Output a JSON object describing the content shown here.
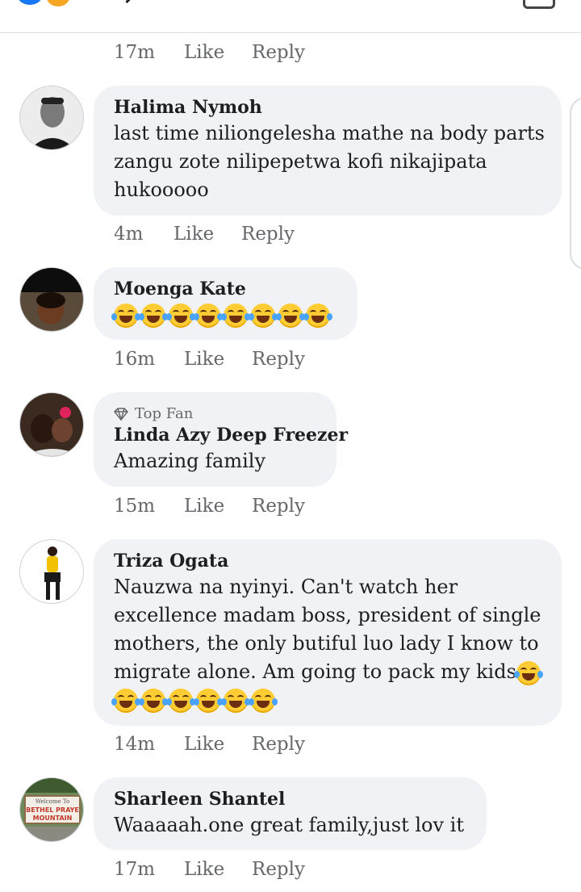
{
  "comments": [
    {
      "meta": {
        "time": "17m",
        "like": "Like",
        "reply": "Reply"
      }
    },
    {
      "name": "Halima Nymoh",
      "lines": [
        "last time niliongelesha mathe na body parts",
        "zangu zote nilipepetwa kofi nikajipata",
        "hukooooo"
      ],
      "meta": {
        "time": "4m",
        "like": "Like",
        "reply": "Reply"
      }
    },
    {
      "name": "Moenga Kate",
      "emoji_count": 8,
      "emoji_icon": "face-with-tears-of-joy",
      "meta": {
        "time": "16m",
        "like": "Like",
        "reply": "Reply"
      }
    },
    {
      "badge": "Top Fan",
      "badge_icon": "diamond-icon",
      "name": "Linda Azy Deep Freezer",
      "lines": [
        "Amazing  family"
      ],
      "meta": {
        "time": "15m",
        "like": "Like",
        "reply": "Reply"
      }
    },
    {
      "name": "Triza Ogata",
      "lines": [
        "Nauzwa na nyinyi. Can't watch her",
        "excellence madam boss, president of single",
        "mothers, the only butiful luo lady I know to",
        "migrate alone. Am going to pack my kids"
      ],
      "emoji_count": 6,
      "emoji_icon": "face-with-tears-of-joy",
      "meta": {
        "time": "14m",
        "like": "Like",
        "reply": "Reply"
      }
    },
    {
      "name": "Sharleen Shantel",
      "lines": [
        "Waaaaah.one great family,just lov it"
      ],
      "avatar_sign": [
        "Welcome To",
        "BETHEL PRAYE",
        "MOUNTAIN"
      ],
      "meta": {
        "time": "17m",
        "like": "Like",
        "reply": "Reply"
      }
    }
  ]
}
